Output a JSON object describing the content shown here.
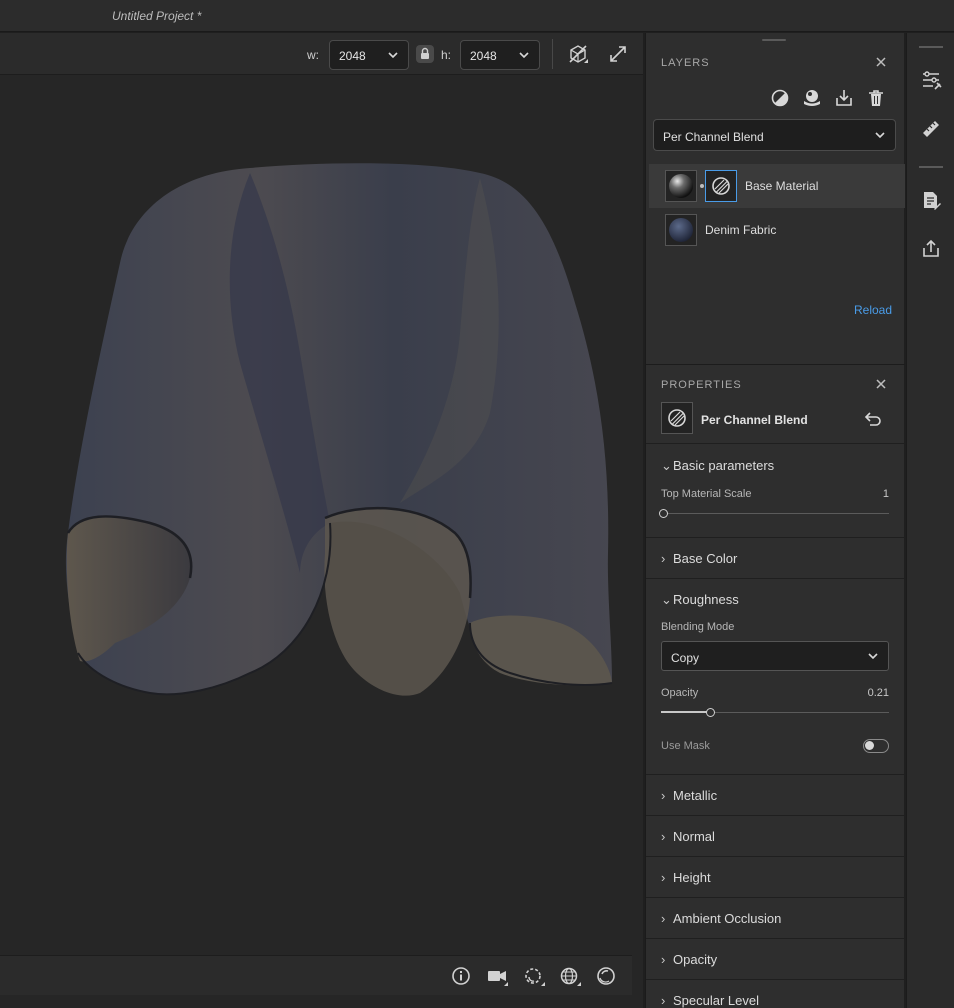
{
  "window": {
    "title": "Untitled Project *"
  },
  "viewport_toolbar": {
    "w_label": "w:",
    "w_value": "2048",
    "h_label": "h:",
    "h_value": "2048",
    "icons": [
      "lock-icon",
      "tile-toggle-icon",
      "fullscreen-icon"
    ]
  },
  "viewport_bottom": {
    "icons": [
      "info-icon",
      "camera-icon",
      "lighting-icon",
      "environment-icon",
      "material-preview-icon"
    ]
  },
  "layers": {
    "title": "LAYERS",
    "toolbar_icons": [
      "add-mask-icon",
      "add-material-icon",
      "import-icon",
      "trash-icon"
    ],
    "blend_type": "Per Channel Blend",
    "items": [
      {
        "name": "Base Material",
        "selected": true
      },
      {
        "name": "Denim Fabric",
        "selected": false
      }
    ],
    "reload_label": "Reload"
  },
  "properties": {
    "title": "PROPERTIES",
    "node_name": "Per Channel Blend",
    "groups": {
      "basic": {
        "title": "Basic parameters",
        "expanded": true,
        "top_material_scale_label": "Top Material Scale",
        "top_material_scale_value": "1",
        "top_material_scale_fraction": 0.0
      },
      "base_color": {
        "title": "Base Color",
        "expanded": false
      },
      "roughness": {
        "title": "Roughness",
        "expanded": true,
        "blending_mode_label": "Blending Mode",
        "blending_mode_value": "Copy",
        "opacity_label": "Opacity",
        "opacity_value": "0.21",
        "opacity_fraction": 0.21,
        "use_mask_label": "Use Mask",
        "use_mask_on": false
      },
      "metallic": {
        "title": "Metallic",
        "expanded": false
      },
      "normal": {
        "title": "Normal",
        "expanded": false
      },
      "height": {
        "title": "Height",
        "expanded": false
      },
      "ambient_occlusion": {
        "title": "Ambient Occlusion",
        "expanded": false
      },
      "opacity": {
        "title": "Opacity",
        "expanded": false
      },
      "specular_level": {
        "title": "Specular Level",
        "expanded": false
      }
    }
  },
  "right_rail": {
    "icons": [
      "parameters-icon",
      "measure-icon",
      "notes-icon",
      "export-icon"
    ]
  },
  "colors": {
    "accent_blue": "#4a9ce8",
    "panel_bg": "#2e2e2e",
    "viewport_bg": "#262626"
  }
}
